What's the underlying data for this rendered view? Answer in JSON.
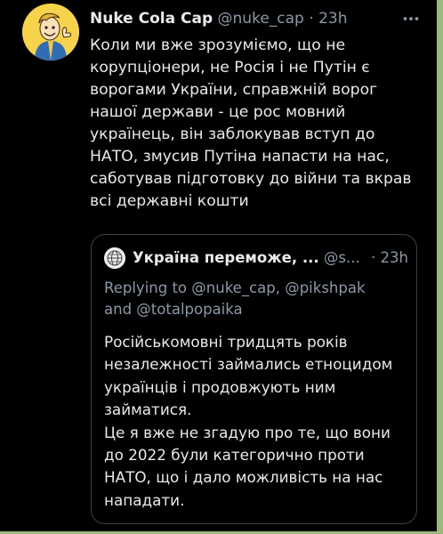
{
  "colors": {
    "background": "#000000",
    "text_primary": "#e7e9ea",
    "text_secondary": "#8b98a5",
    "border": "#3a4048",
    "avatar_bg": "#f6d34a",
    "edge_green": "#9ab97a"
  },
  "tweet": {
    "display_name": "Nuke Cola Cap",
    "handle": "@nuke_cap",
    "separator": "·",
    "time": "23h",
    "more_icon": "more-horizontal-icon",
    "avatar_icon": "vault-boy-avatar-icon",
    "text": "Коли ми вже зрозуміємо, що не\nкорупціонери, не Росія і не Путін є\nворогами України, справжній ворог\nнашої держави - це рос мовний\nукраїнець, він заблокував вступ до\nНАТО, змусив Путіна напасти на нас,\nсаботував підготовку до війни та вкрав\nвсі державні кошти"
  },
  "quoted": {
    "display_name": "Україна переможе, ...",
    "handle": "@s...",
    "separator": "·",
    "time": "23h",
    "avatar_icon": "globe-avatar-icon",
    "replying_prefix": "Replying to",
    "replying_to": "@nuke_cap, @pikshpak",
    "replying_and": "and",
    "replying_last": "@totalpopaika",
    "text": "Російськомовні тридцять років\nнезалежності займались етноцидом\nукраїнців і продовжують ним\nзайматися.\nЦе я вже не згадую про те, що вони\nдо 2022 були категорично проти\nНАТО, що і дало можливість на нас\nнападати."
  }
}
